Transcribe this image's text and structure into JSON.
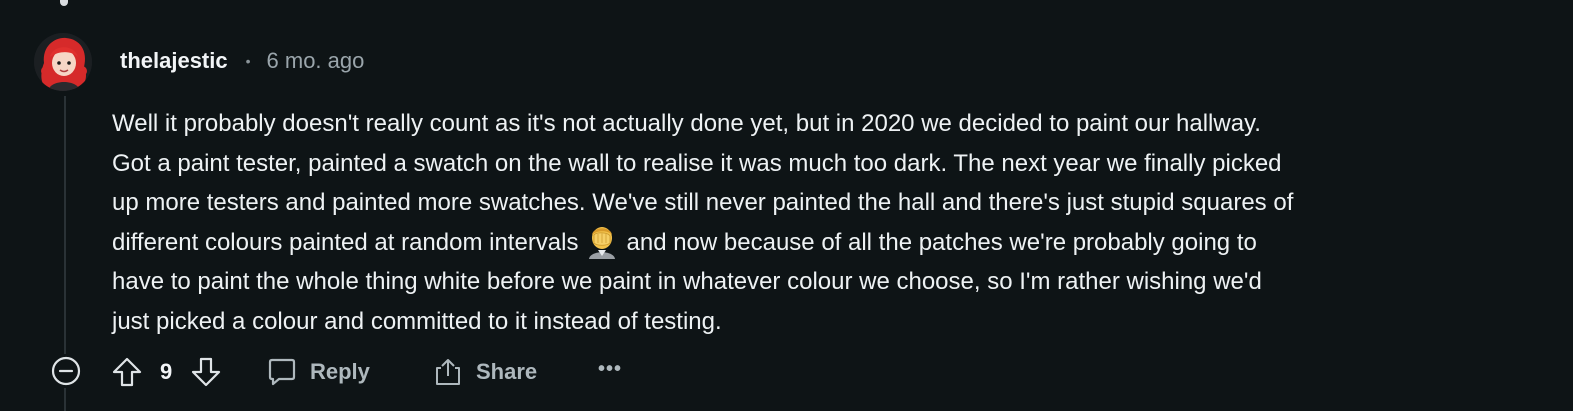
{
  "comment": {
    "username": "thelajestic",
    "separator": "•",
    "timestamp": "6 mo. ago",
    "avatar": "red-haired-avatar",
    "body": {
      "line1": "Well it probably doesn't really count as it's not actually done yet, but in 2020 we decided to paint our hallway.",
      "line2": "Got a paint tester, painted a swatch on the wall to realise it was much too dark. The next year we finally picked",
      "line3": "up more testers and painted more swatches. We've still never painted the hall and there's just stupid squares of",
      "line4_before_emoji": "different colours painted at random intervals",
      "line4_after_emoji": "and now because of all the patches we're probably going to",
      "line5": "have to paint the whole thing white before we paint in whatever colour we choose, so I'm rather wishing we'd",
      "line6": "just picked a colour and committed to it instead of testing.",
      "emoji": "facepalm-emoji"
    }
  },
  "actions": {
    "collapse_icon": "minus-circle-icon",
    "upvote_icon": "upvote-arrow-icon",
    "vote_count": "9",
    "downvote_icon": "downvote-arrow-icon",
    "reply_label": "Reply",
    "reply_icon": "speech-bubble-icon",
    "share_label": "Share",
    "share_icon": "share-upload-icon",
    "more_label": "•••"
  },
  "colors": {
    "background": "#0e1416",
    "text": "#eef2f4",
    "muted": "#9aa5ab",
    "action": "#aeb8bd",
    "thread_line": "#2a3236"
  }
}
